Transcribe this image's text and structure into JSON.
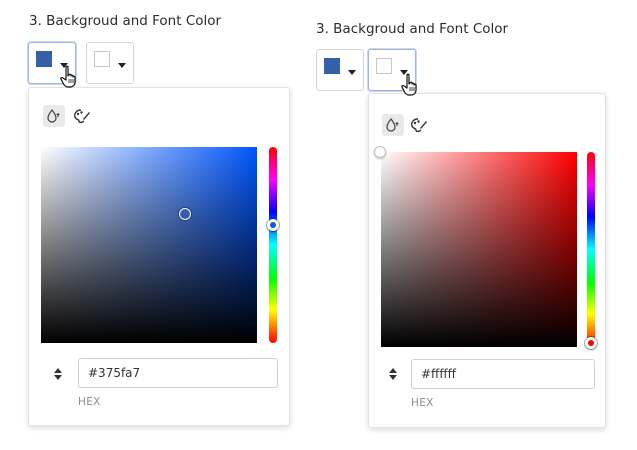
{
  "left": {
    "section_title": "3. Backgroud and Font Color",
    "background_swatch_color": "#375fa7",
    "font_swatch_color": "#ffffff",
    "picker": {
      "hue_color": "#0055ff",
      "hex_value": "#375fa7",
      "format_label": "HEX"
    }
  },
  "right": {
    "section_title": "3. Backgroud and Font Color",
    "background_swatch_color": "#375fa7",
    "font_swatch_color": "#ffffff",
    "picker": {
      "hue_color": "#ff0000",
      "hex_value": "#ffffff",
      "format_label": "HEX"
    }
  },
  "icons": {
    "dropper_mode": "water-drop-icon",
    "palette_mode": "palette-icon",
    "cursor": "hand-pointer-icon",
    "format_toggle": "up-down-arrows-icon"
  },
  "colors": {
    "swatch_active_border": "#9fb7d6",
    "mode_selected_bg": "#e9e9e9"
  }
}
